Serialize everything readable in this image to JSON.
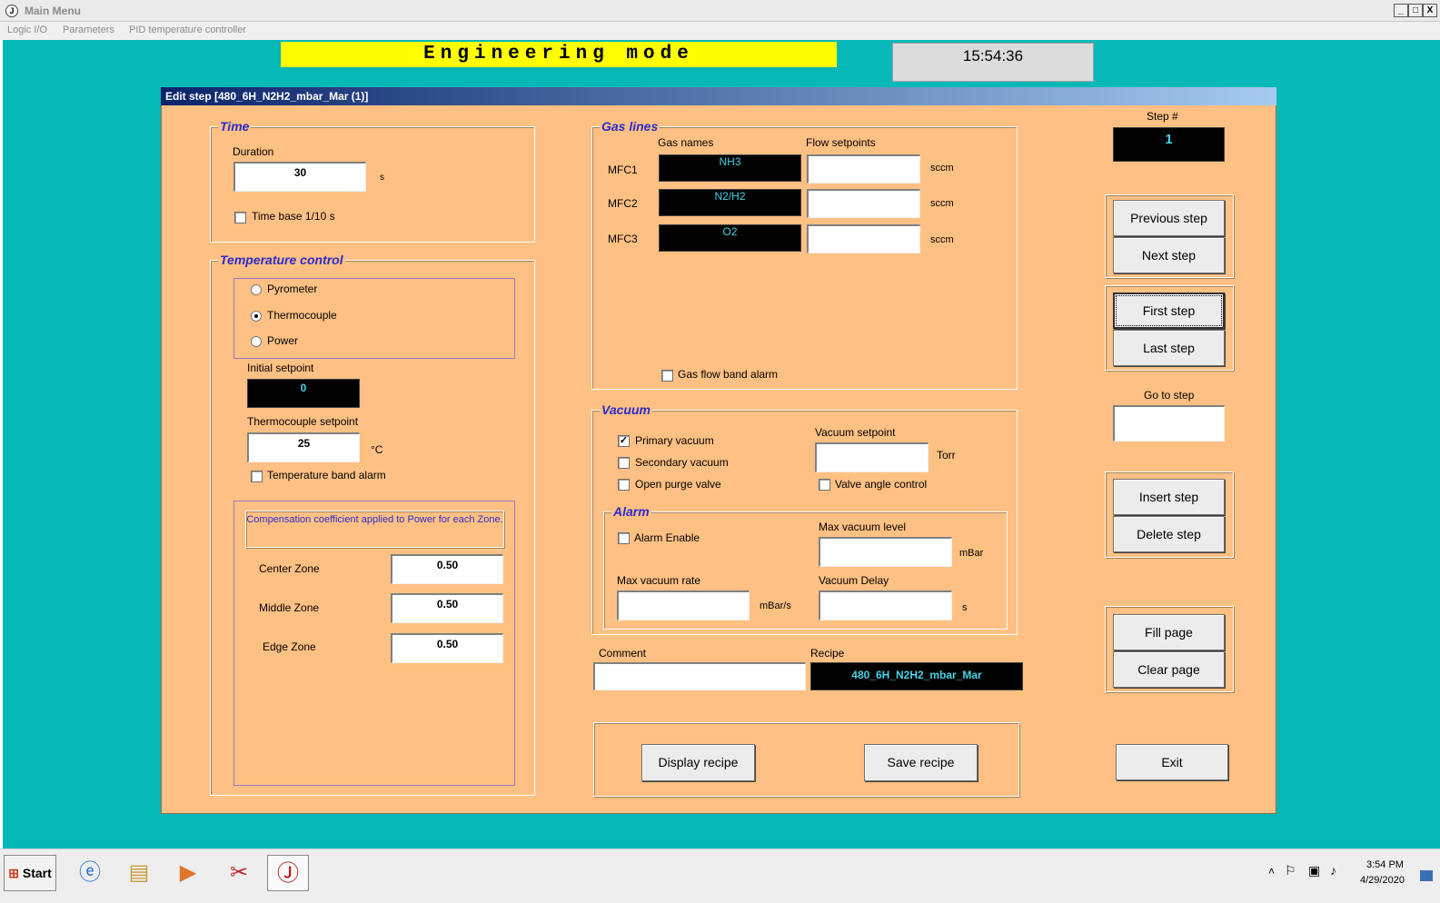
{
  "window": {
    "title": "Main Menu",
    "menu": [
      "Logic I/O",
      "Parameters",
      "PID temperature controller"
    ],
    "controls": [
      "_",
      "□",
      "X"
    ]
  },
  "banner": {
    "mode": "Engineering  mode",
    "clock": "15:54:36"
  },
  "dialog": {
    "title": "Edit step [480_6H_N2H2_mbar_Mar (1)]",
    "time": {
      "title": "Time",
      "duration_label": "Duration",
      "duration_value": "30",
      "unit": "s",
      "timebase_label": "Time base 1/10 s"
    },
    "temperature": {
      "title": "Temperature control",
      "radios": [
        "Pyrometer",
        "Thermocouple",
        "Power"
      ],
      "selected": "Thermocouple",
      "initial_label": "Initial setpoint",
      "initial_value": "0",
      "tc_label": "Thermocouple setpoint",
      "tc_value": "25",
      "tc_unit": "°C",
      "band_alarm": "Temperature band alarm",
      "comp_title": "Compensation coefficient applied to Power for each Zone.",
      "zones": [
        {
          "label": "Center Zone",
          "value": "0.50"
        },
        {
          "label": "Middle Zone",
          "value": "0.50"
        },
        {
          "label": "Edge Zone",
          "value": "0.50"
        }
      ]
    },
    "gas": {
      "title": "Gas lines",
      "names_header": "Gas names",
      "flow_header": "Flow setpoints",
      "rows": [
        {
          "label": "MFC1",
          "name": "NH3",
          "unit": "sccm"
        },
        {
          "label": "MFC2",
          "name": "N2/H2",
          "unit": "sccm"
        },
        {
          "label": "MFC3",
          "name": "O2",
          "unit": "sccm"
        }
      ],
      "band_alarm": "Gas flow band alarm"
    },
    "vacuum": {
      "title": "Vacuum",
      "primary": "Primary vacuum",
      "secondary": "Secondary vacuum",
      "purge": "Open purge valve",
      "setpoint_label": "Vacuum setpoint",
      "setpoint_unit": "Torr",
      "angle": "Valve angle control",
      "alarm": {
        "title": "Alarm",
        "enable": "Alarm Enable",
        "max_level_label": "Max vacuum level",
        "max_level_unit": "mBar",
        "max_rate_label": "Max vacuum rate",
        "max_rate_unit": "mBar/s",
        "delay_label": "Vacuum Delay",
        "delay_unit": "s"
      }
    },
    "comment_label": "Comment",
    "recipe_label": "Recipe",
    "recipe_value": "480_6H_N2H2_mbar_Mar",
    "display_recipe": "Display recipe",
    "save_recipe": "Save recipe",
    "step_label": "Step #",
    "step_value": "1",
    "previous_step": "Previous step",
    "next_step": "Next step",
    "first_step": "First step",
    "last_step": "Last step",
    "goto_label": "Go to step",
    "insert_step": "Insert step",
    "delete_step": "Delete step",
    "fill_page": "Fill page",
    "clear_page": "Clear page",
    "exit": "Exit"
  },
  "taskbar": {
    "start": "Start",
    "time": "3:54 PM",
    "date": "4/29/2020"
  }
}
